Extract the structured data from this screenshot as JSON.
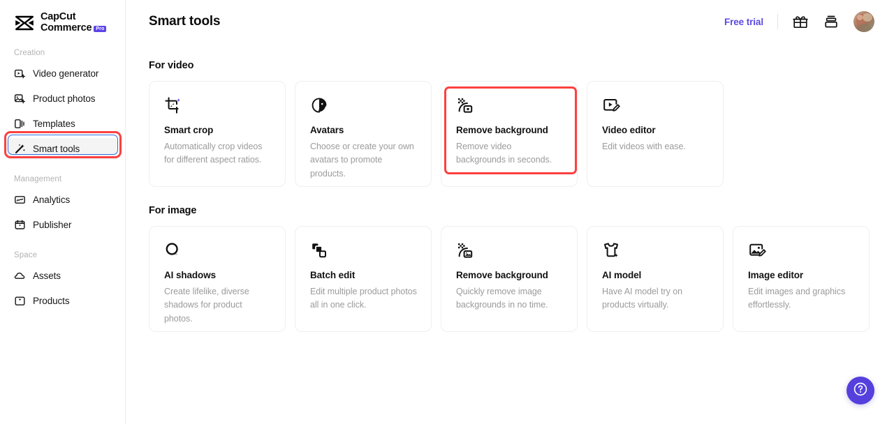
{
  "brand": {
    "line1": "CapCut",
    "line2": "Commerce",
    "badge": "Pro",
    "badge_color": "#5c43e8",
    "logo_icon": "capcut-hourglass-logo"
  },
  "sidebar": {
    "sections": [
      {
        "label": "Creation",
        "items": [
          {
            "label": "Video generator",
            "icon": "video-add-icon",
            "active": false
          },
          {
            "label": "Product photos",
            "icon": "image-add-icon",
            "active": false
          },
          {
            "label": "Templates",
            "icon": "templates-icon",
            "active": false
          },
          {
            "label": "Smart tools",
            "icon": "magic-wand-icon",
            "active": true
          }
        ]
      },
      {
        "label": "Management",
        "items": [
          {
            "label": "Analytics",
            "icon": "analytics-chart-icon",
            "active": false
          },
          {
            "label": "Publisher",
            "icon": "calendar-publisher-icon",
            "active": false
          }
        ]
      },
      {
        "label": "Space",
        "items": [
          {
            "label": "Assets",
            "icon": "cloud-icon",
            "active": false
          },
          {
            "label": "Products",
            "icon": "product-box-icon",
            "active": false
          }
        ]
      }
    ]
  },
  "header": {
    "title": "Smart tools",
    "free_trial_label": "Free trial",
    "free_trial_color": "#5b4ae0",
    "gift_icon": "gift-icon",
    "stack_icon": "stack-box-icon",
    "avatar_icon": "user-avatar"
  },
  "main": {
    "sections": [
      {
        "heading": "For video",
        "cards": [
          {
            "title": "Smart crop",
            "desc": "Automatically crop videos for different aspect ratios.",
            "icon": "smart-crop-icon",
            "highlighted": false
          },
          {
            "title": "Avatars",
            "desc": "Choose or create your own avatars to promote products.",
            "icon": "avatar-profile-icon",
            "highlighted": false
          },
          {
            "title": "Remove background",
            "desc": "Remove video backgrounds in seconds.",
            "icon": "remove-background-video-icon",
            "highlighted": true
          },
          {
            "title": "Video editor",
            "desc": "Edit videos with ease.",
            "icon": "video-edit-icon",
            "highlighted": false
          }
        ]
      },
      {
        "heading": "For image",
        "cards": [
          {
            "title": "AI shadows",
            "desc": "Create lifelike, diverse shadows for product photos.",
            "icon": "shadow-circle-icon",
            "highlighted": false
          },
          {
            "title": "Batch edit",
            "desc": "Edit multiple product photos all in one click.",
            "icon": "batch-squares-icon",
            "highlighted": false
          },
          {
            "title": "Remove background",
            "desc": "Quickly remove image backgrounds in no time.",
            "icon": "remove-background-image-icon",
            "highlighted": false
          },
          {
            "title": "AI model",
            "desc": "Have AI model try on products virtually.",
            "icon": "tshirt-sparkle-icon",
            "highlighted": false
          },
          {
            "title": "Image editor",
            "desc": "Edit images and graphics effortlessly.",
            "icon": "image-edit-icon",
            "highlighted": false
          }
        ]
      }
    ]
  },
  "help": {
    "icon": "question-mark-icon",
    "color": "#5540dd"
  },
  "annotation": {
    "color": "#fc4040",
    "focus_ring_color": "#2f6fe0"
  }
}
